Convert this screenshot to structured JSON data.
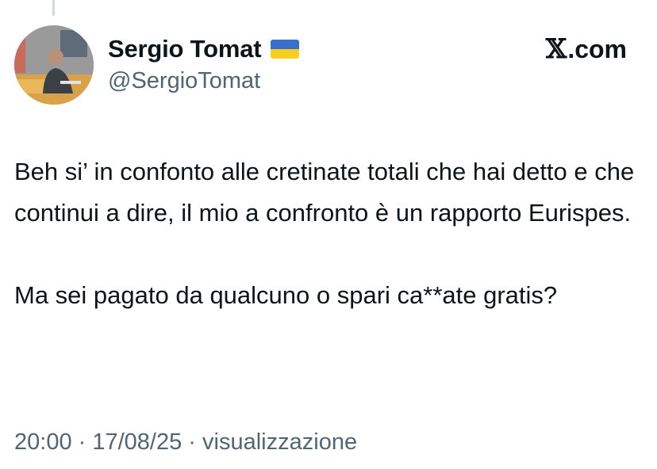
{
  "tweet": {
    "author": {
      "display_name": "Sergio Tomat",
      "flag_icon": "ukraine-flag-icon",
      "handle": "@SergioTomat"
    },
    "brand": {
      "x_glyph": "𝕏",
      "domain": ".com"
    },
    "paragraphs": [
      "Beh si’ in confonto alle cretinate totali che hai detto e che continui a dire, il mio a confronto è un rapporto Eurispes.",
      "Ma sei pagato da qualcuno o spari ca**ate gratis?"
    ],
    "meta": {
      "time": "20:00",
      "separator_1": " · ",
      "date": "17/08/25",
      "separator_2": " · ",
      "views_label": "visualizzazione"
    }
  },
  "colors": {
    "text": "#0f1419",
    "secondary": "#536471",
    "flag_blue": "#3a6fd0",
    "flag_yellow": "#f7cf1d"
  }
}
